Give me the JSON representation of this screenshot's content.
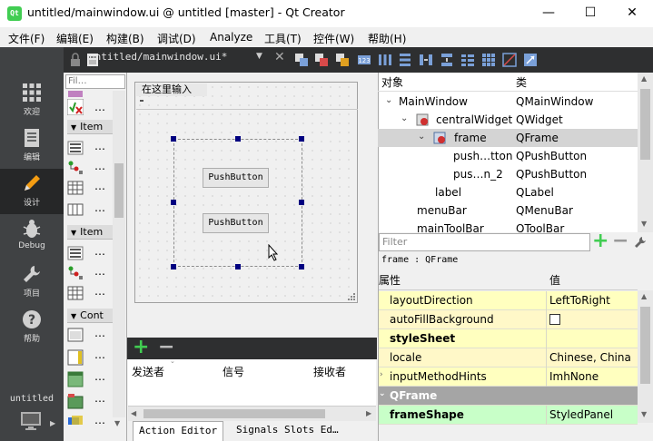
{
  "window": {
    "app_icon_text": "Qt",
    "title": "untitled/mainwindow.ui @ untitled [master] - Qt Creator",
    "minimize": "—",
    "maximize": "☐",
    "close": "✕"
  },
  "menubar": {
    "items": [
      "文件(F)",
      "编辑(E)",
      "构建(B)",
      "调试(D)",
      "Analyze",
      "工具(T)",
      "控件(W)",
      "帮助(H)"
    ]
  },
  "modebar": {
    "items": [
      {
        "label": "欢迎",
        "icon": "grid-icon"
      },
      {
        "label": "编辑",
        "icon": "document-icon"
      },
      {
        "label": "设计",
        "icon": "pencil-icon"
      },
      {
        "label": "Debug",
        "icon": "bug-icon"
      },
      {
        "label": "项目",
        "icon": "wrench-icon"
      },
      {
        "label": "帮助",
        "icon": "help-icon"
      }
    ],
    "active": 2,
    "project_label": "untitled"
  },
  "editor": {
    "document_tab": "untitled/mainwindow.ui*",
    "close_doc": "✕"
  },
  "widgetbox": {
    "filter_placeholder": "Fil…",
    "dots": "…",
    "categories": [
      "Item",
      "Item",
      "Cont"
    ]
  },
  "form": {
    "menu_placeholder": "在这里输入",
    "buttons": [
      "PushButton",
      "PushButton"
    ]
  },
  "signals": {
    "columns": [
      "发送者",
      "信号",
      "接收者"
    ],
    "add": "+",
    "remove": "−",
    "tabs": [
      "Action Editor",
      "Signals  Slots Ed…"
    ]
  },
  "object_inspector": {
    "headers": [
      "对象",
      "类"
    ],
    "rows": [
      {
        "name": "MainWindow",
        "class": "QMainWindow"
      },
      {
        "name": "centralWidget",
        "class": "QWidget"
      },
      {
        "name": "frame",
        "class": "QFrame"
      },
      {
        "name": "push…tton",
        "class": "QPushButton"
      },
      {
        "name": "pus…n_2",
        "class": "QPushButton"
      },
      {
        "name": "label",
        "class": "QLabel"
      },
      {
        "name": "menuBar",
        "class": "QMenuBar"
      },
      {
        "name": "mainToolBar",
        "class": "QToolBar"
      }
    ]
  },
  "property_editor": {
    "filter_placeholder": "Filter",
    "add": "+",
    "remove": "−",
    "object_line": "frame : QFrame",
    "headers": [
      "属性",
      "值"
    ],
    "rows": [
      {
        "name": "layoutDirection",
        "value": "LeftToRight"
      },
      {
        "name": "autoFillBackground",
        "value": ""
      },
      {
        "name": "styleSheet",
        "value": ""
      },
      {
        "name": "locale",
        "value": "Chinese, China"
      },
      {
        "name": "inputMethodHints",
        "value": "ImhNone"
      },
      {
        "name": "QFrame",
        "value": ""
      },
      {
        "name": "frameShape",
        "value": "StyledPanel"
      }
    ]
  }
}
